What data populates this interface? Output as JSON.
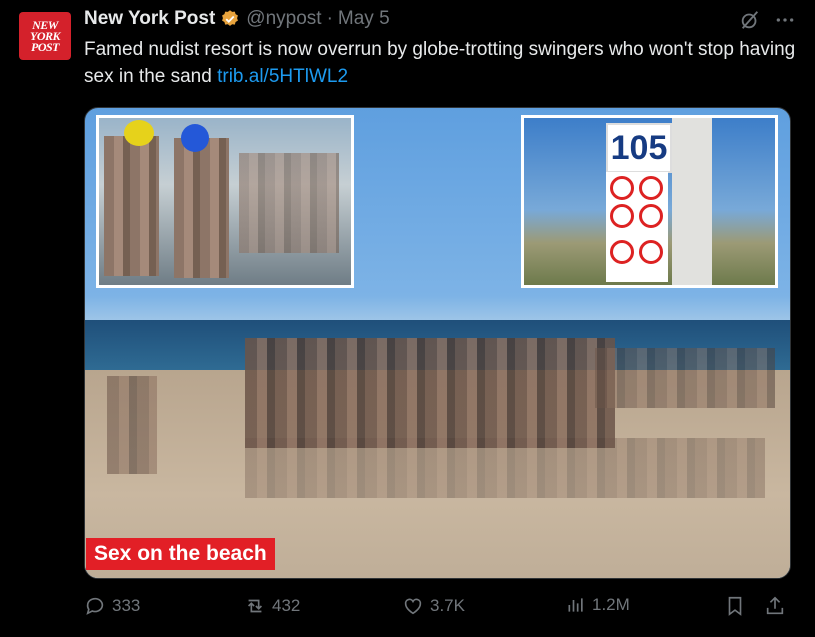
{
  "author": {
    "avatar_lines": [
      "NEW",
      "YORK",
      "POST"
    ],
    "name": "New York Post",
    "handle": "@nypost",
    "separator": "·",
    "date": "May 5"
  },
  "tweet": {
    "text": "Famed nudist resort is now overrun by globe-trotting swingers who won't stop having sex in the sand ",
    "link": "trib.al/5HTlWL2"
  },
  "media": {
    "caption": "Sex on the beach",
    "sign_number": "105",
    "caption_color": "#e21f26"
  },
  "actions": {
    "replies": "333",
    "reposts": "432",
    "likes": "3.7K",
    "views": "1.2M"
  },
  "colors": {
    "link": "#1d9bf0",
    "muted": "#71767b",
    "verified_badge": "#e8a33d"
  },
  "icons": [
    "verified-icon",
    "grok-icon",
    "more-icon",
    "reply-icon",
    "repost-icon",
    "like-icon",
    "views-icon",
    "bookmark-icon",
    "share-icon"
  ]
}
